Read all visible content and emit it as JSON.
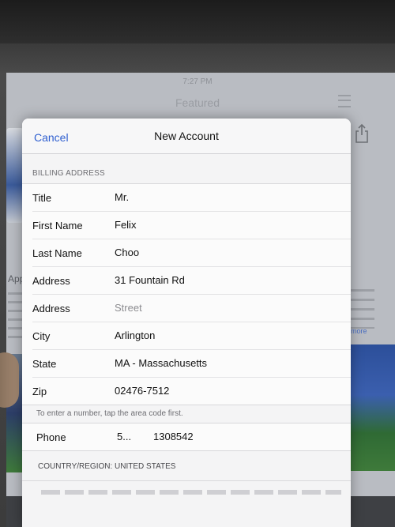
{
  "background": {
    "status_time": "7:27 PM",
    "nav_title": "Featured",
    "left_snippet": "App",
    "right_link": "more"
  },
  "modal": {
    "cancel_label": "Cancel",
    "title": "New Account",
    "section_header": "BILLING ADDRESS",
    "rows": [
      {
        "label": "Title",
        "value": "Mr.",
        "placeholder": ""
      },
      {
        "label": "First Name",
        "value": "Felix",
        "placeholder": ""
      },
      {
        "label": "Last Name",
        "value": "Choo",
        "placeholder": ""
      },
      {
        "label": "Address",
        "value": "31 Fountain Rd",
        "placeholder": ""
      },
      {
        "label": "Address",
        "value": "",
        "placeholder": "Street"
      },
      {
        "label": "City",
        "value": "Arlington",
        "placeholder": ""
      },
      {
        "label": "State",
        "value": "MA - Massachusetts",
        "placeholder": ""
      },
      {
        "label": "Zip",
        "value": "02476-7512",
        "placeholder": ""
      }
    ],
    "phone_hint": "To enter a number, tap the area code first.",
    "phone": {
      "label": "Phone",
      "area_code": "5...",
      "number": "1308542"
    },
    "country_footer": "COUNTRY/REGION: UNITED STATES"
  },
  "colors": {
    "accent": "#2f5fd0",
    "sheet_background": "#f4f4f5"
  },
  "icons": [
    "share-icon",
    "list-icon",
    "star-icon"
  ]
}
